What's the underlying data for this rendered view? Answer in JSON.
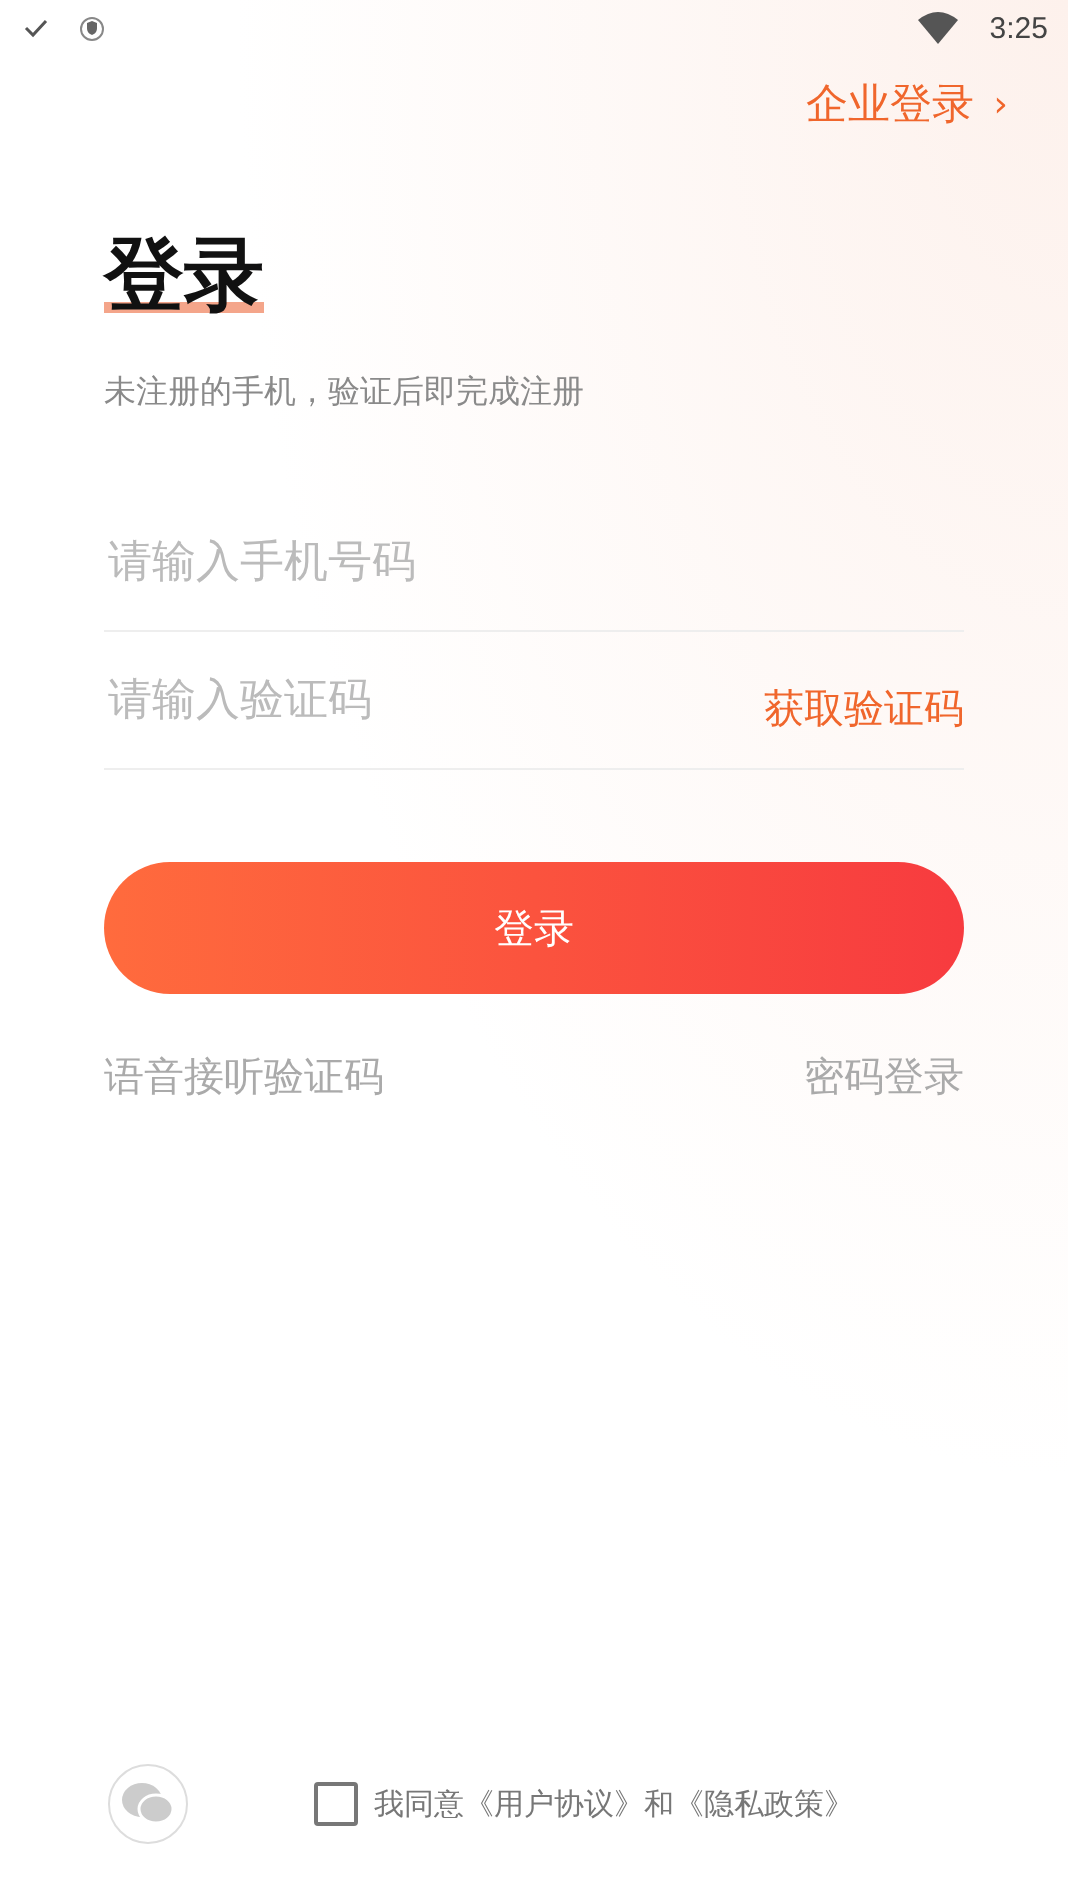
{
  "status_bar": {
    "time": "3:25"
  },
  "enterprise_login": {
    "label": "企业登录",
    "chevron": "›"
  },
  "title": "登录",
  "subtitle": "未注册的手机，验证后即完成注册",
  "phone_field": {
    "placeholder": "请输入手机号码"
  },
  "code_field": {
    "placeholder": "请输入验证码",
    "action": "获取验证码"
  },
  "login_button": "登录",
  "links": [
    "语音接听验证码",
    "密码登录"
  ],
  "agreement": {
    "checked": false,
    "text": "我同意《用户协议》和《隐私政策》"
  }
}
